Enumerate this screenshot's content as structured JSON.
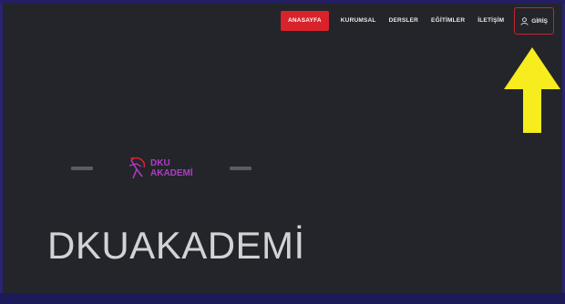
{
  "nav": {
    "items": [
      {
        "label": "ANASAYFA",
        "active": true
      },
      {
        "label": "KURUMSAL",
        "active": false
      },
      {
        "label": "DERSLER",
        "active": false
      },
      {
        "label": "EĞİTİMLER",
        "active": false
      },
      {
        "label": "İLETİŞİM",
        "active": false
      }
    ],
    "login_label": "GİRİŞ",
    "login_icon": "user-icon"
  },
  "logo": {
    "line1": "DKU",
    "line2": "AKADEMİ",
    "icon": "runner-logo-icon"
  },
  "hero": {
    "title": "DKUAKADEMİ"
  },
  "annotation": {
    "icon": "arrow-up-icon",
    "color": "#f7ec1d"
  },
  "colors": {
    "background": "#23252b",
    "accent_red": "#d9222a",
    "logo_purple": "#b13bc4",
    "frame_blue": "#2a2473"
  }
}
